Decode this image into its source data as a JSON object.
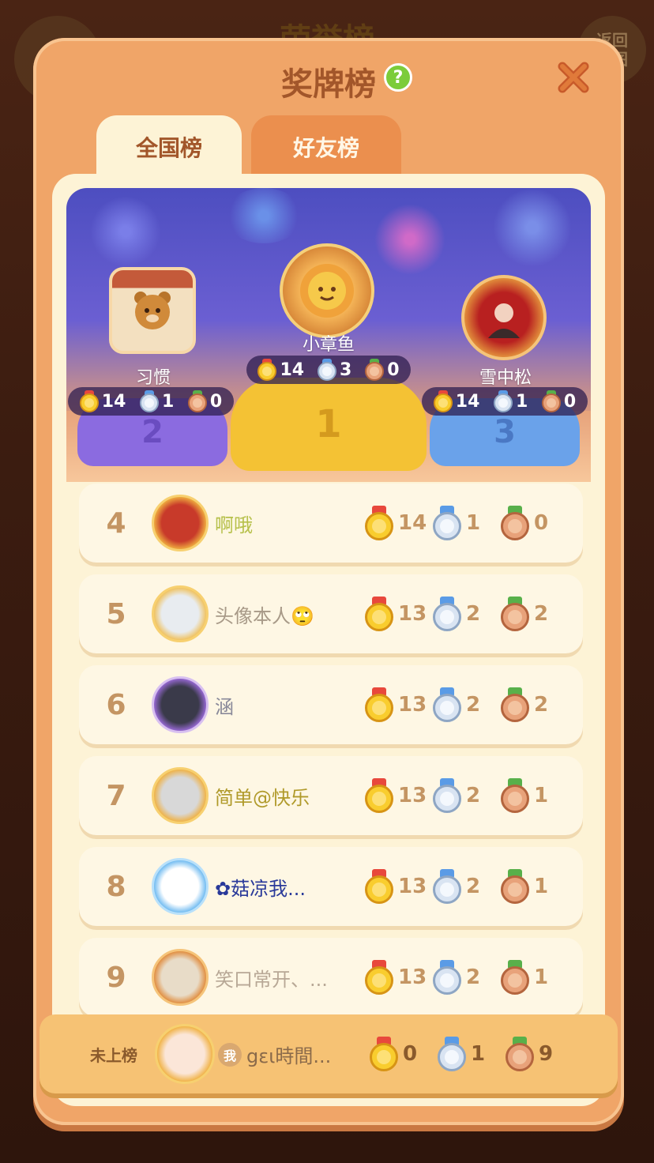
{
  "background": {
    "title": "荣誉榜",
    "back_label": "返回\n地图"
  },
  "modal": {
    "title": "奖牌榜",
    "tabs": [
      {
        "label": "全国榜",
        "active": true
      },
      {
        "label": "好友榜",
        "active": false
      }
    ]
  },
  "podium": [
    {
      "place": 1,
      "name": "小章鱼",
      "gold": "14",
      "silver": "3",
      "bronze": "0"
    },
    {
      "place": 2,
      "name": "习惯",
      "gold": "14",
      "silver": "1",
      "bronze": "0"
    },
    {
      "place": 3,
      "name": "雪中松",
      "gold": "14",
      "silver": "1",
      "bronze": "0"
    }
  ],
  "podium_labels": {
    "first": "1",
    "second": "2",
    "third": "3"
  },
  "rows": [
    {
      "rank": "4",
      "name": "啊哦",
      "gold": "14",
      "silver": "1",
      "bronze": "0",
      "name_color": "#b6c04a"
    },
    {
      "rank": "5",
      "name": "头像本人🙄",
      "gold": "13",
      "silver": "2",
      "bronze": "2",
      "name_color": "#a89a88"
    },
    {
      "rank": "6",
      "name": "涵",
      "gold": "13",
      "silver": "2",
      "bronze": "2",
      "name_color": "#8a8a9a"
    },
    {
      "rank": "7",
      "name": "简单@快乐",
      "gold": "13",
      "silver": "2",
      "bronze": "1",
      "name_color": "#b09a2a"
    },
    {
      "rank": "8",
      "name": "✿菇凉我...",
      "gold": "13",
      "silver": "2",
      "bronze": "1",
      "name_color": "#2a3a9a"
    },
    {
      "rank": "9",
      "name": "笑口常开、...",
      "gold": "13",
      "silver": "2",
      "bronze": "1",
      "name_color": "#b8a896"
    }
  ],
  "me": {
    "label": "未上榜",
    "tag": "我",
    "name": "gει時間...",
    "gold": "0",
    "silver": "1",
    "bronze": "9"
  },
  "colors": {
    "modal_bg": "#f0a568",
    "panel_bg": "#fdf3d6",
    "title": "#a2562a",
    "rank": "#c49563"
  },
  "icons": [
    "help-icon",
    "close-icon",
    "gold-medal-icon",
    "silver-medal-icon",
    "bronze-medal-icon"
  ]
}
